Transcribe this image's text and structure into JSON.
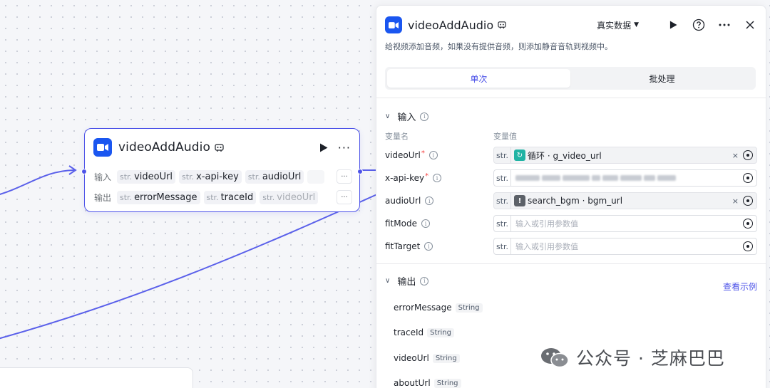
{
  "node": {
    "title": "videoAddAudio",
    "input_label": "输入",
    "output_label": "输出",
    "inputs": [
      {
        "type": "str.",
        "name": "videoUrl"
      },
      {
        "type": "str.",
        "name": "x-api-key"
      },
      {
        "type": "str.",
        "name": "audioUrl"
      }
    ],
    "outputs": [
      {
        "type": "str.",
        "name": "errorMessage"
      },
      {
        "type": "str.",
        "name": "traceId"
      },
      {
        "type": "str.",
        "name": "videoUrl"
      }
    ],
    "more_glyph": "···",
    "run_icon": "play-icon",
    "app_icon": "video-camera-icon"
  },
  "panel": {
    "title": "videoAddAudio",
    "data_mode": "真实数据",
    "description": "给视频添加音频，如果没有提供音频，则添加静音音轨到视频中。",
    "tabs": [
      {
        "label": "单次",
        "active": true
      },
      {
        "label": "批处理",
        "active": false
      }
    ],
    "input_section": {
      "title": "输入",
      "col_name": "变量名",
      "col_value": "变量值",
      "params": [
        {
          "name": "videoUrl",
          "required": true,
          "type": "str.",
          "kind": "ref",
          "ref_icon": "loop-icon",
          "ref_text": "循环 · g_video_url",
          "clearable": true
        },
        {
          "name": "x-api-key",
          "required": true,
          "type": "str.",
          "kind": "masked",
          "clearable": false
        },
        {
          "name": "audioUrl",
          "required": false,
          "type": "str.",
          "kind": "ref",
          "ref_icon": "warning-icon",
          "ref_text": "search_bgm · bgm_url",
          "clearable": true
        },
        {
          "name": "fitMode",
          "required": false,
          "type": "str.",
          "kind": "empty",
          "placeholder": "输入或引用参数值",
          "clearable": false
        },
        {
          "name": "fitTarget",
          "required": false,
          "type": "str.",
          "kind": "empty",
          "placeholder": "输入或引用参数值",
          "clearable": false
        }
      ]
    },
    "output_section": {
      "title": "输出",
      "example_link": "查看示例",
      "items": [
        {
          "name": "errorMessage",
          "type": "String"
        },
        {
          "name": "traceId",
          "type": "String"
        },
        {
          "name": "videoUrl",
          "type": "String"
        },
        {
          "name": "aboutUrl",
          "type": "String"
        }
      ]
    },
    "clear_glyph": "×"
  },
  "watermark": {
    "text": "公众号 · 芝麻巴巴"
  },
  "colors": {
    "accent": "#4d53e8",
    "app_icon_bg": "#1a56f0",
    "loop_tag": "#20b3a4",
    "required_mark": "#f53f3f"
  }
}
